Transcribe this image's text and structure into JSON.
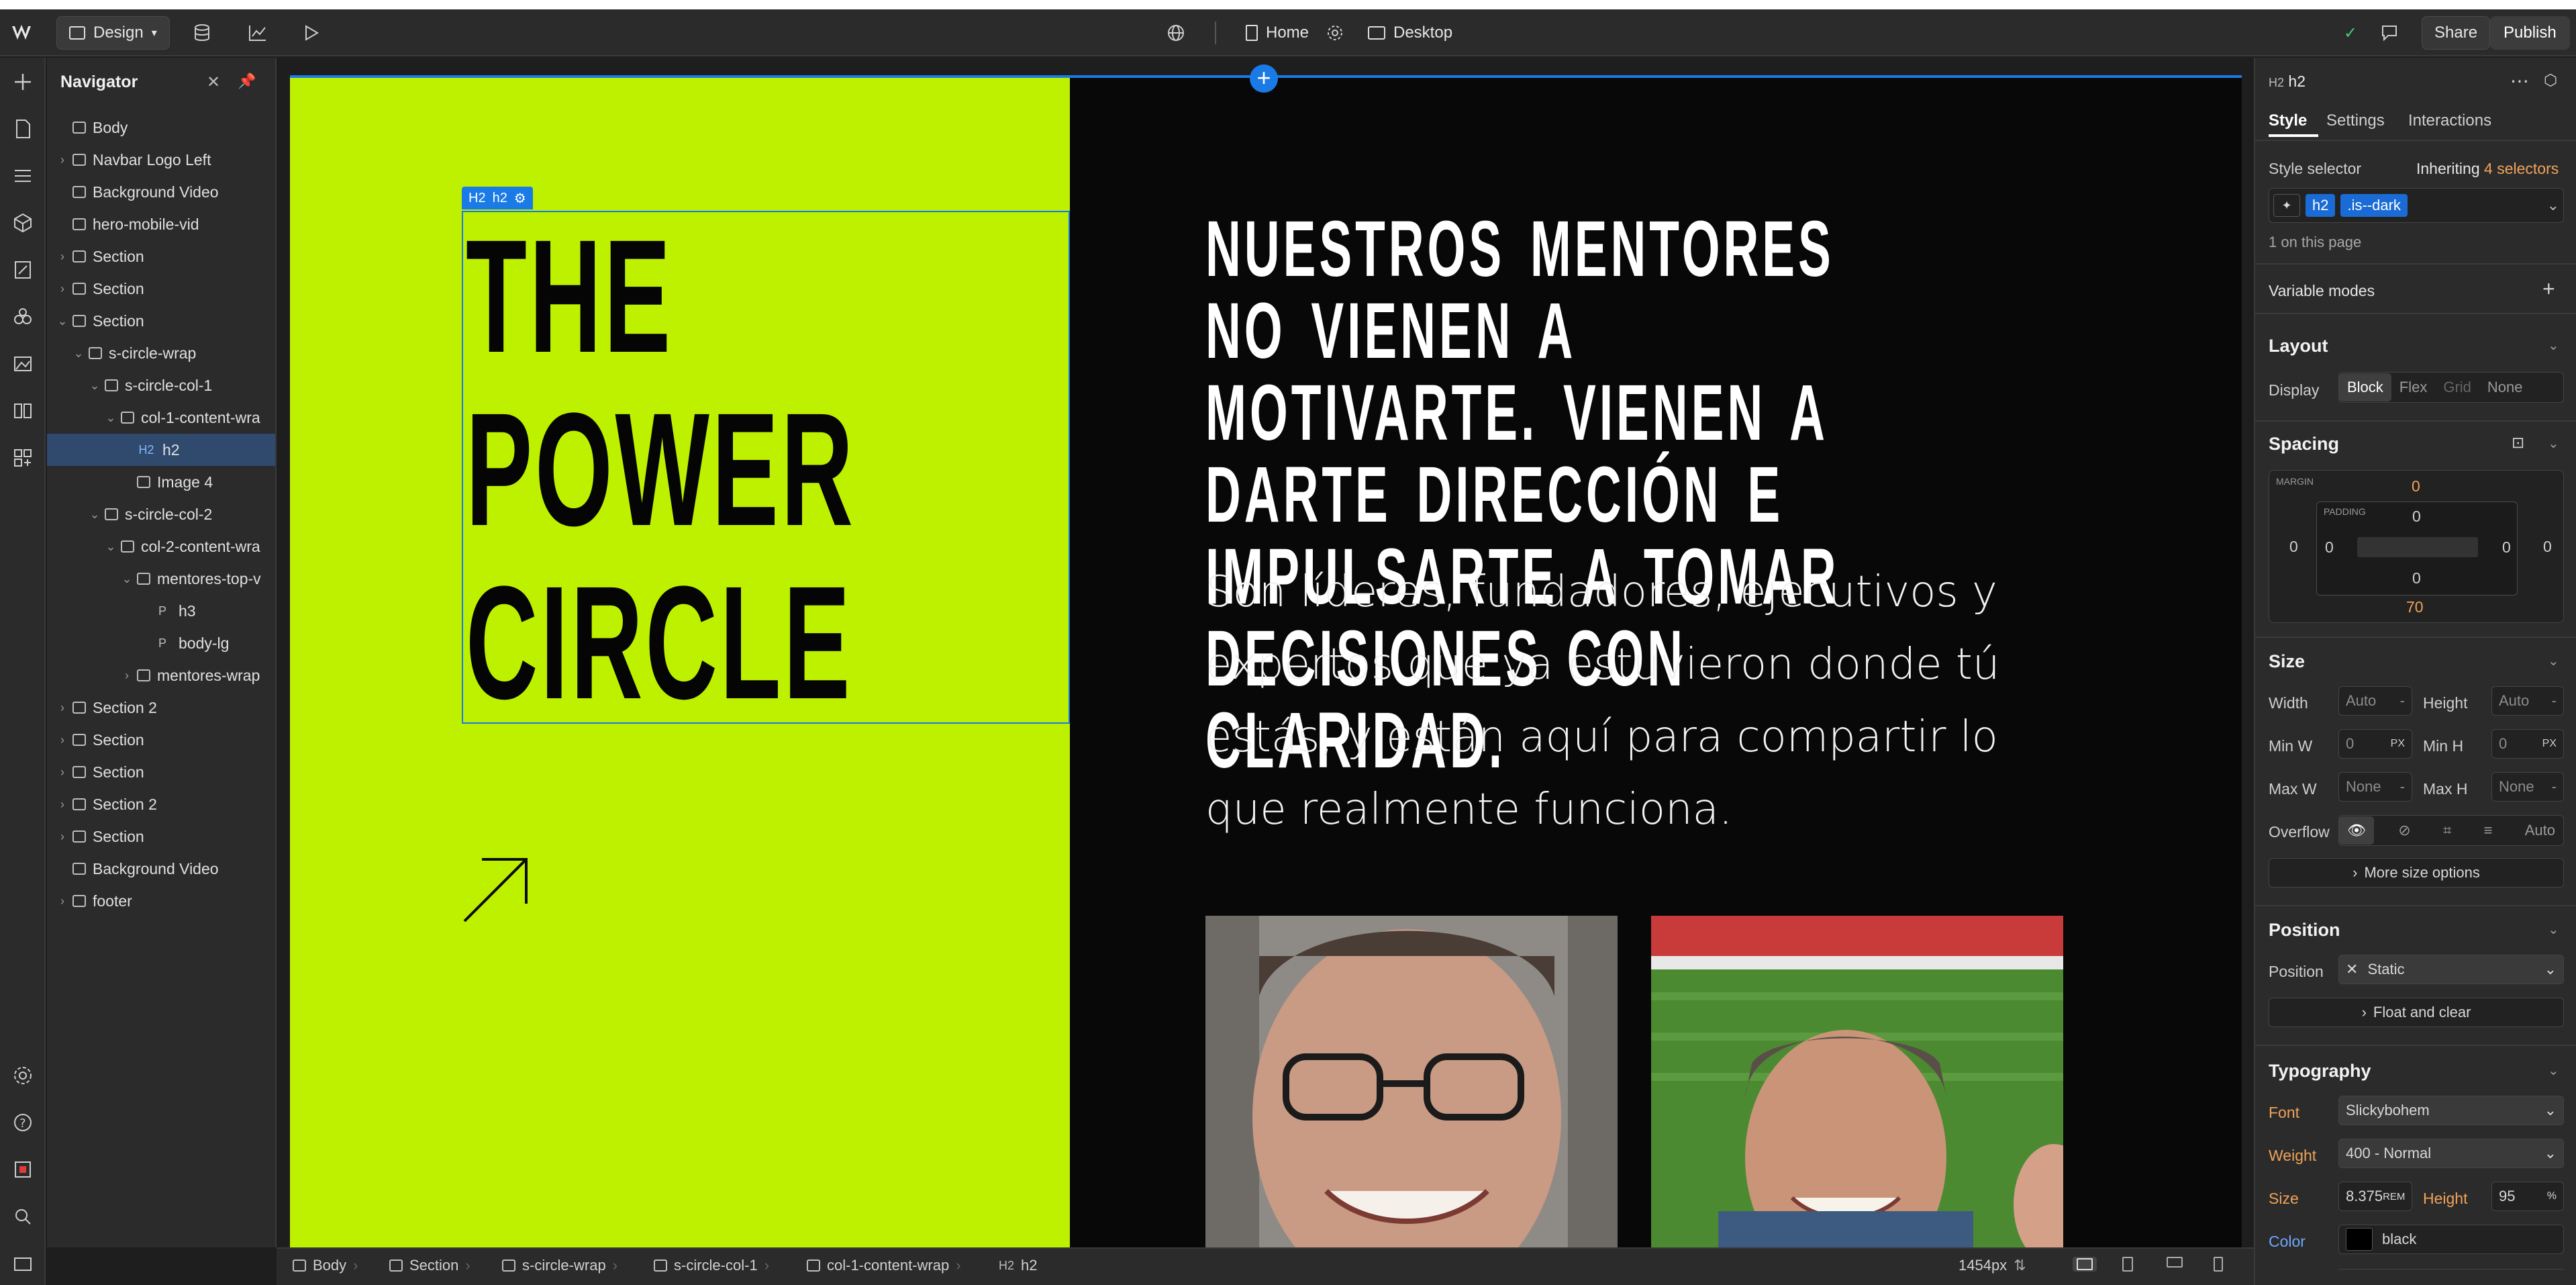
{
  "topbar": {
    "mode_label": "Design",
    "page_label": "Home",
    "breakpoint_label": "Desktop",
    "share_label": "Share",
    "publish_label": "Publish"
  },
  "navigator": {
    "title": "Navigator",
    "items": [
      {
        "label": "Body",
        "icon": "box"
      },
      {
        "label": "Navbar Logo Left",
        "icon": "box"
      },
      {
        "label": "Background Video",
        "icon": "video"
      },
      {
        "label": "hero-mobile-vid",
        "icon": "video"
      },
      {
        "label": "Section",
        "icon": "box"
      },
      {
        "label": "Section",
        "icon": "box"
      },
      {
        "label": "Section",
        "icon": "box"
      },
      {
        "label": "s-circle-wrap",
        "icon": "box"
      },
      {
        "label": "s-circle-col-1",
        "icon": "box"
      },
      {
        "label": "col-1-content-wra",
        "icon": "box"
      },
      {
        "label": "h2",
        "icon": "H2"
      },
      {
        "label": "Image 4",
        "icon": "image"
      },
      {
        "label": "s-circle-col-2",
        "icon": "box"
      },
      {
        "label": "col-2-content-wra",
        "icon": "box"
      },
      {
        "label": "mentores-top-v",
        "icon": "box"
      },
      {
        "label": "h3",
        "icon": "P"
      },
      {
        "label": "body-lg",
        "icon": "P"
      },
      {
        "label": "mentores-wrap",
        "icon": "box"
      },
      {
        "label": "Section 2",
        "icon": "box"
      },
      {
        "label": "Section",
        "icon": "box"
      },
      {
        "label": "Section",
        "icon": "box"
      },
      {
        "label": "Section 2",
        "icon": "box"
      },
      {
        "label": "Section",
        "icon": "box"
      },
      {
        "label": "Background Video",
        "icon": "video"
      },
      {
        "label": "footer",
        "icon": "box"
      }
    ]
  },
  "canvas": {
    "selected_tag": "H2",
    "selected_label": "h2",
    "hero_title": "THE POWER CIRCLE",
    "headline": "NUESTROS MENTORES NO VIENEN A MOTIVARTE. VIENEN A DARTE DIRECCIÓN E IMPULSARTE A TOMAR DECISIONES CON CLARIDAD.",
    "body": "Son líderes, fundadores, ejecutivos y expertos que ya estuvieron donde tú estás, y están aquí para compartir lo que realmente funciona.",
    "colors": {
      "accent_green": "#bdf100",
      "dark_bg": "#080808",
      "selection_blue": "#1a7ae6"
    }
  },
  "breadcrumbs": [
    {
      "label": "Body"
    },
    {
      "label": "Section"
    },
    {
      "label": "s-circle-wrap"
    },
    {
      "label": "s-circle-col-1"
    },
    {
      "label": "col-1-content-wrap"
    },
    {
      "label": "h2",
      "tag": "H2"
    }
  ],
  "bottombar": {
    "width_label": "1454px"
  },
  "style_panel": {
    "element_tag": "H2",
    "element_name": "h2",
    "tabs": [
      "Style",
      "Settings",
      "Interactions"
    ],
    "selector_label": "Style selector",
    "inheriting_prefix": "Inheriting",
    "inheriting_count": "4 selectors",
    "selector_chips": [
      "h2",
      ".is--dark"
    ],
    "on_page": "1 on this page",
    "variable_modes": "Variable modes",
    "layout": {
      "title": "Layout",
      "display_label": "Display",
      "display_options": [
        "Block",
        "Flex",
        "Grid",
        "None"
      ]
    },
    "spacing": {
      "title": "Spacing",
      "margin_label": "MARGIN",
      "padding_label": "PADDING",
      "margin_top": "0",
      "margin_bottom": "70",
      "margin_left": "0",
      "margin_right": "0",
      "padding_top": "0",
      "padding_bottom": "0",
      "padding_left": "0",
      "padding_right": "0"
    },
    "size": {
      "title": "Size",
      "width_label": "Width",
      "width_value": "Auto",
      "height_label": "Height",
      "height_value": "Auto",
      "minw_label": "Min W",
      "minw_value": "0",
      "minw_unit": "PX",
      "minh_label": "Min H",
      "minh_value": "0",
      "minh_unit": "PX",
      "maxw_label": "Max W",
      "maxw_value": "None",
      "maxh_label": "Max H",
      "maxh_value": "None",
      "overflow_label": "Overflow",
      "overflow_auto": "Auto",
      "more_label": "More size options"
    },
    "position": {
      "title": "Position",
      "position_label": "Position",
      "position_value": "Static",
      "float_label": "Float and clear"
    },
    "typography": {
      "title": "Typography",
      "font_label": "Font",
      "font_value": "Slickybohem",
      "weight_label": "Weight",
      "weight_value": "400 - Normal",
      "size_label": "Size",
      "size_value": "8.375",
      "size_unit": "REM",
      "height_label": "Height",
      "height_value": "95",
      "height_unit": "%",
      "color_label": "Color",
      "color_value": "black",
      "color_swatch": "#000000"
    }
  }
}
